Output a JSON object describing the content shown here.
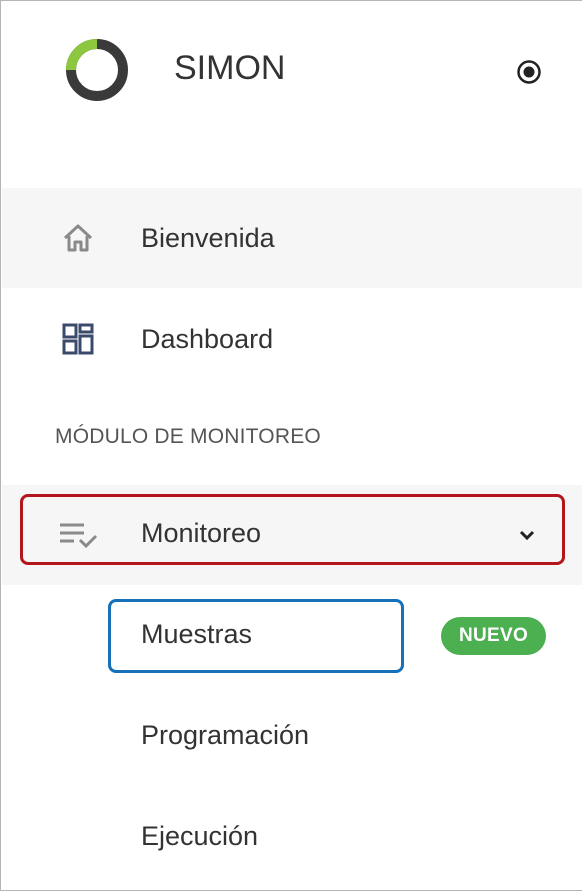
{
  "app": {
    "title": "SIMON",
    "logo_colors": {
      "ring": "#3a3a3a",
      "accent": "#8dc63f"
    }
  },
  "header": {
    "settings_icon": "radio-target-icon"
  },
  "nav": {
    "items": [
      {
        "label": "Bienvenida",
        "icon": "home-icon",
        "active": true
      },
      {
        "label": "Dashboard",
        "icon": "dashboard-icon",
        "active": false
      }
    ]
  },
  "section": {
    "title": "MÓDULO DE MONITOREO"
  },
  "group": {
    "label": "Monitoreo",
    "icon": "checklist-icon",
    "expanded": true,
    "chevron_icon": "chevron-down-icon",
    "sub_items": [
      {
        "label": "Muestras",
        "badge": "NUEVO"
      },
      {
        "label": "Programación"
      },
      {
        "label": "Ejecución"
      }
    ]
  },
  "colors": {
    "badge_bg": "#4caf50",
    "highlight_red": "#b3161b",
    "highlight_blue": "#1570b8",
    "active_bg": "#f6f6f6",
    "dashboard_icon": "#3b4a6b"
  }
}
